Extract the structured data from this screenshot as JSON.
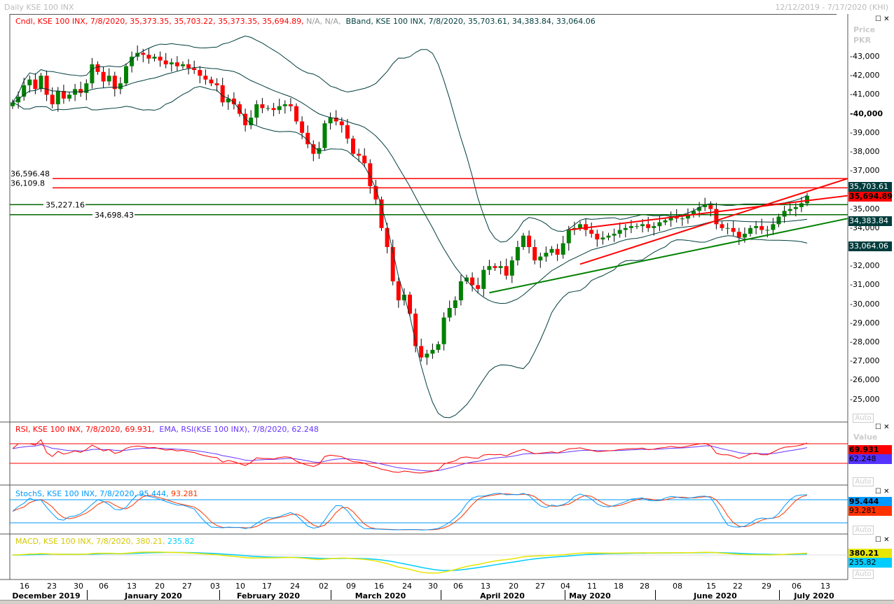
{
  "header": {
    "title": "Daily KSE 100 INX",
    "range": "12/12/2019 - 7/17/2020 (KHI)"
  },
  "legends": {
    "candle": "Cndl, KSE 100 INX, 7/8/2020, 35,373.35, 35,703.22, 35,373.35, 35,694.89,",
    "candle_na": "N/A, N/A,",
    "bband": "BBand, KSE 100 INX, 7/8/2020, 35,703.61, 34,383.84, 33,064.06",
    "rsi": "RSI, KSE 100 INX, 7/8/2020, 69.931,",
    "ema": "EMA, RSI(KSE 100 INX), 7/8/2020, 62.248",
    "stoch": "StochS, KSE 100 INX, 7/8/2020, 95.444,",
    "stoch2": "93.281",
    "macd": "MACD, KSE 100 INX, 7/8/2020, 380.21,",
    "macd2": "235.82"
  },
  "axis": {
    "price_label": "Price",
    "currency": "PKR",
    "value_label": "Value",
    "auto": "Auto",
    "price_ticks": [
      "43,000",
      "42,000",
      "41,000",
      "40,000",
      "39,000",
      "38,000",
      "37,000",
      "35,000",
      "34,000",
      "32,000",
      "31,000",
      "30,000",
      "29,000",
      "28,000",
      "27,000",
      "26,000",
      "25,000"
    ],
    "tags": {
      "bb_upper": "35,703.61",
      "close": "35,694.89",
      "bb_mid": "34,383.84",
      "bb_lower": "33,064.06",
      "rsi": "69.931",
      "ema": "62.248",
      "stoch_k": "95.444",
      "stoch_d": "93.281",
      "macd": "380.21",
      "signal": "235.82"
    }
  },
  "colors": {
    "up": "#008000",
    "down": "#ff0000",
    "bband": "#003c3c",
    "rsi": "#ff0000",
    "ema": "#6633ff",
    "stoch_k": "#0099ff",
    "stoch_d": "#ff3300",
    "macd": "#e6e600",
    "signal": "#00ccff"
  },
  "chart_data": {
    "type": "candlestick",
    "title": "Daily KSE 100 INX",
    "ylabel": "Price PKR",
    "ylim": [
      24500,
      44000
    ],
    "closes": [
      40600,
      40900,
      41500,
      41800,
      41300,
      42000,
      41000,
      40500,
      41200,
      40800,
      41000,
      41300,
      41100,
      41600,
      42600,
      42200,
      41700,
      42000,
      41300,
      41600,
      42500,
      43000,
      43200,
      43100,
      42900,
      43000,
      42800,
      42600,
      42700,
      42500,
      42600,
      42400,
      42300,
      42000,
      41800,
      41600,
      41500,
      40600,
      40800,
      40500,
      40000,
      39400,
      39800,
      40500,
      40300,
      40300,
      40200,
      40400,
      40500,
      40400,
      39600,
      39000,
      38400,
      37900,
      38200,
      39500,
      39800,
      39600,
      39400,
      38700,
      37900,
      37800,
      37400,
      36200,
      35500,
      34000,
      33000,
      31200,
      30200,
      30500,
      29500,
      27800,
      27200,
      27400,
      27600,
      27900,
      29300,
      29800,
      30200,
      31200,
      31400,
      31000,
      30800,
      31800,
      32000,
      31900,
      32000,
      31500,
      32300,
      33000,
      33600,
      33000,
      32300,
      32500,
      32700,
      32900,
      32600,
      33200,
      33900,
      34000,
      34200,
      33900,
      33700,
      33400,
      33500,
      33600,
      33700,
      33900,
      34000,
      34100,
      34100,
      34200,
      34000,
      34100,
      34300,
      34400,
      34600,
      34500,
      34500,
      34700,
      34900,
      35100,
      35200,
      35000,
      34200,
      34000,
      34000,
      33800,
      33500,
      33700,
      34000,
      34100,
      33900,
      33900,
      34200,
      34600,
      34900,
      35000,
      35100,
      35300,
      35694.89
    ],
    "hlines": [
      {
        "label": "36,596.48",
        "value": 36596.48,
        "color": "#ff0000"
      },
      {
        "label": "36,109.8",
        "value": 36109.8,
        "color": "#ff0000"
      },
      {
        "label": "35,227.16",
        "value": 35227.16,
        "color": "#006400"
      },
      {
        "label": "34,698.43",
        "value": 34698.43,
        "color": "#006400"
      }
    ],
    "trendlines": [
      {
        "from": [
          98,
          33900
        ],
        "to": [
          149,
          35700
        ],
        "color": "#ff0000"
      },
      {
        "from": [
          100,
          32100
        ],
        "to": [
          149,
          36600
        ],
        "color": "#ff0000"
      },
      {
        "from": [
          84,
          30600
        ],
        "to": [
          149,
          34500
        ],
        "color": "#008000"
      }
    ],
    "x_ticks": [
      "16",
      "23",
      "30",
      "06",
      "13",
      "20",
      "27",
      "03",
      "10",
      "17",
      "24",
      "02",
      "09",
      "16",
      "24",
      "30",
      "06",
      "13",
      "20",
      "27",
      "04",
      "11",
      "18",
      "28",
      "08",
      "15",
      "22",
      "29",
      "06",
      "13"
    ],
    "months": [
      "December 2019",
      "January 2020",
      "February 2020",
      "March 2020",
      "April 2020",
      "May 2020",
      "June 2020",
      "July 2020"
    ],
    "rsi_levels": [
      70,
      30
    ],
    "stoch_levels": [
      80,
      20
    ]
  }
}
